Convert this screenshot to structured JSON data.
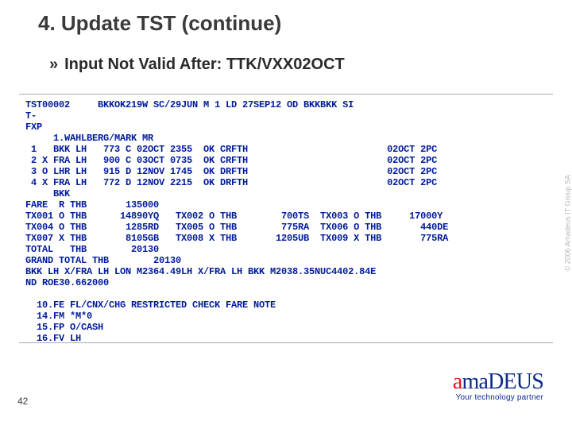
{
  "header": {
    "title": "4. Update TST (continue)"
  },
  "bullet": {
    "icon": "»",
    "text": "Input Not Valid After: TTK/VXX02OCT"
  },
  "terminal": {
    "lines": [
      "TST00002     BKKOK219W SC/29JUN M 1 LD 27SEP12 OD BKKBKK SI",
      "T-",
      "FXP",
      "     1.WAHLBERG/MARK MR",
      " 1   BKK LH   773 C 02OCT 2355  OK CRFTH                         02OCT 2PC",
      " 2 X FRA LH   900 C 03OCT 0735  OK CRFTH                         02OCT 2PC",
      " 3 O LHR LH   915 D 12NOV 1745  OK DRFTH                         02OCT 2PC",
      " 4 X FRA LH   772 D 12NOV 2215  OK DRFTH                         02OCT 2PC",
      "     BKK",
      "FARE  R THB       135000",
      "TX001 O THB      14890YQ   TX002 O THB        700TS  TX003 O THB     17000Y",
      "TX004 O THB       1285RD   TX005 O THB        775RA  TX006 O THB       440DE",
      "TX007 X THB       8105GB   TX008 X THB       1205UB  TX009 X THB       775RA",
      "TOTAL   THB        20130",
      "GRAND TOTAL THB        20130",
      "BKK LH X/FRA LH LON M2364.49LH X/FRA LH BKK M2038.35NUC4402.84E",
      "ND ROE30.662000",
      "",
      "  10.FE FL/CNX/CHG RESTRICTED CHECK FARE NOTE",
      "  14.FM *M*0",
      "  15.FP O/CASH",
      "  16.FV LH"
    ]
  },
  "footer": {
    "page_number": "42",
    "copyright": "© 2006 Amadeus IT Group SA",
    "brand_name": "amaDEUS",
    "brand_a": "a",
    "brand_rest": "maDEUS",
    "tagline": "Your technology partner"
  }
}
